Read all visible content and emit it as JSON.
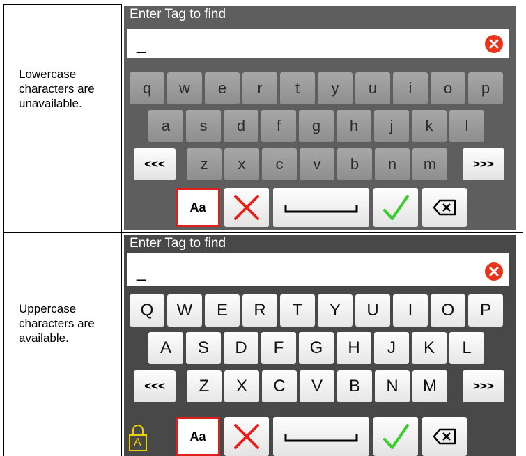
{
  "rows": [
    {
      "description": "Lowercase characters are unavailable."
    },
    {
      "description": "Uppercase characters are available."
    }
  ],
  "keyboard": {
    "header_label": "Enter Tag to find",
    "input_value": "_",
    "prev_label": "<<<",
    "next_label": ">>>",
    "case_label": "Aa",
    "lower_rows": [
      [
        "q",
        "w",
        "e",
        "r",
        "t",
        "y",
        "u",
        "i",
        "o",
        "p"
      ],
      [
        "a",
        "s",
        "d",
        "f",
        "g",
        "h",
        "j",
        "k",
        "l"
      ],
      [
        "z",
        "x",
        "c",
        "v",
        "b",
        "n",
        "m"
      ]
    ],
    "upper_rows": [
      [
        "Q",
        "W",
        "E",
        "R",
        "T",
        "Y",
        "U",
        "I",
        "O",
        "P"
      ],
      [
        "A",
        "S",
        "D",
        "F",
        "G",
        "H",
        "J",
        "K",
        "L"
      ],
      [
        "Z",
        "X",
        "C",
        "V",
        "B",
        "N",
        "M"
      ]
    ],
    "caps_lock_letter": "A"
  },
  "colors": {
    "clear_red": "#e8341c",
    "cancel_red": "#e8201a",
    "confirm_green": "#3ccc2c",
    "aa_border": "#e01e1e"
  },
  "icons": {
    "clear": "clear-circle-icon",
    "cancel": "cross-icon",
    "space": "space-bar-icon",
    "confirm": "checkmark-icon",
    "backspace": "backspace-icon",
    "lock": "caps-lock-icon"
  }
}
